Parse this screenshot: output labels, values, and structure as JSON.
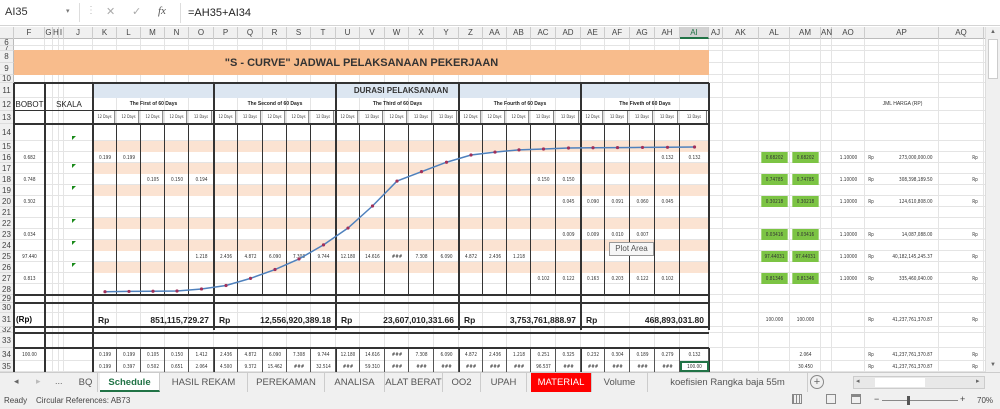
{
  "formula_bar": {
    "name_box": "AI35",
    "cancel_icon": "✕",
    "enter_icon": "✓",
    "fx_label": "fx",
    "formula": "=AH35+AI34"
  },
  "columns": [
    "F",
    "G",
    "H",
    "I",
    "J",
    "K",
    "L",
    "M",
    "N",
    "O",
    "P",
    "Q",
    "R",
    "S",
    "T",
    "U",
    "V",
    "W",
    "X",
    "Y",
    "Z",
    "AA",
    "AB",
    "AC",
    "AD",
    "AE",
    "AF",
    "AG",
    "AH",
    "AI",
    "AJ",
    "AK",
    "AL",
    "AM",
    "AN",
    "AO",
    "AP",
    "AQ"
  ],
  "selected_column": "AI",
  "title": "\"S - CURVE\" JADWAL PELAKSANAAN PEKERJAAN",
  "headers": {
    "bobot": "BOBOT",
    "skala": "SKALA",
    "durasi": "DURASI PELAKSANAAN",
    "jml_harga": "JML HARGA (RP)",
    "periods": [
      "The First of 60 Days",
      "The Second of 60 Days",
      "The Third of 60 Days",
      "The Fourth of 60 Days",
      "The Fiveth of 60 Days"
    ],
    "sub_period": "12 Days"
  },
  "colors": {
    "title_band": "#f8bc8c",
    "header_band": "#dce6f1",
    "stripe": "#fbe3d2",
    "green_cell": "#7cc444",
    "curve": "#4f81bd",
    "marker": "#a0305a",
    "active_tab": "#217346",
    "material_tab": "#ff0000"
  },
  "rows": [
    {
      "row": "16",
      "cells": {
        "F": "0.682",
        "K": "0.199",
        "L": "0.199",
        "AH": "0.132",
        "AI": "0.132",
        "AL": "0.68202",
        "AM": "0.68202",
        "AO": "1.10000",
        "AP_rp": "Rp",
        "AP": "273,000,000.00",
        "AQ": "Rp"
      }
    },
    {
      "row": "18",
      "cells": {
        "F": "0.748",
        "M": "0.105",
        "N": "0.150",
        "O": "0.194",
        "AC": "0.150",
        "AD": "0.150",
        "AL": "0.74785",
        "AM": "0.74785",
        "AO": "1.10000",
        "AP_rp": "Rp",
        "AP": "308,398,189.50",
        "AQ": "Rp"
      }
    },
    {
      "row": "20",
      "cells": {
        "F": "0.302",
        "AD": "0.045",
        "AE": "0.090",
        "AF": "0.091",
        "AG": "0.060",
        "AH": "0.045",
        "AL": "0.30218",
        "AM": "0.30218",
        "AO": "1.10000",
        "AP_rp": "Rp",
        "AP": "124,610,808.00",
        "AQ": "Rp"
      }
    },
    {
      "row": "23",
      "cells": {
        "F": "0.034",
        "AD": "0.009",
        "AE": "0.009",
        "AF": "0.010",
        "AG": "0.007",
        "AL": "0.03416",
        "AM": "0.03416",
        "AO": "1.10000",
        "AP_rp": "Rp",
        "AP": "14,087,088.00",
        "AQ": "Rp"
      }
    },
    {
      "row": "25",
      "cells": {
        "F": "97.440",
        "O": "1.218",
        "P": "2.436",
        "Q": "4.872",
        "R": "6.090",
        "S": "7.308",
        "T": "9.744",
        "U": "12.180",
        "V": "14.616",
        "W": "###",
        "X": "7.308",
        "Y": "6.090",
        "Z": "4.872",
        "AA": "2.436",
        "AB": "1.218",
        "AL": "97.44031",
        "AM": "97.44031",
        "AO": "1.10000",
        "AP_rp": "Rp",
        "AP": "40,182,145,245.37",
        "AQ": "Rp"
      }
    },
    {
      "row": "27",
      "cells": {
        "F": "0.813",
        "AC": "0.102",
        "AD": "0.122",
        "AE": "0.163",
        "AF": "0.203",
        "AG": "0.122",
        "AH": "0.102",
        "AL": "0.81346",
        "AM": "0.81346",
        "AO": "1.10000",
        "AP_rp": "Rp",
        "AP": "335,460,040.00",
        "AQ": "Rp"
      }
    },
    {
      "row": "31",
      "cells": {
        "F": "(Rp)",
        "AL": "100.000",
        "AM": "100.000",
        "AP_rp": "Rp",
        "AP": "41,237,761,370.87",
        "AQ": "Rp"
      }
    },
    {
      "row": "34",
      "cells": {
        "F": "100.00",
        "K": "0.199",
        "L": "0.199",
        "M": "0.105",
        "N": "0.150",
        "O": "1.412",
        "P": "2.436",
        "Q": "4.872",
        "R": "6.090",
        "S": "7.308",
        "T": "9.744",
        "U": "12.180",
        "V": "14.616",
        "W": "###",
        "X": "7.308",
        "Y": "6.090",
        "Z": "4.872",
        "AA": "2.436",
        "AB": "1.218",
        "AC": "0.251",
        "AD": "0.325",
        "AE": "0.232",
        "AF": "0.304",
        "AG": "0.189",
        "AH": "0.279",
        "AI": "0.132",
        "AM": "2.064",
        "AP_rp": "Rp",
        "AP": "41,237,761,370.87",
        "AQ": "Rp"
      }
    },
    {
      "row": "35",
      "cells": {
        "K": "0.199",
        "L": "0.397",
        "M": "0.502",
        "N": "0.651",
        "O": "2.064",
        "P": "4.500",
        "Q": "9.372",
        "R": "15.462",
        "S": "###",
        "T": "32.514",
        "U": "###",
        "V": "59.310",
        "W": "###",
        "X": "###",
        "Y": "###",
        "Z": "###",
        "AA": "###",
        "AB": "###",
        "AC": "96.537",
        "AD": "###",
        "AE": "###",
        "AF": "###",
        "AG": "###",
        "AH": "###",
        "AI": "100.00",
        "AM": "30.450",
        "AP_rp": "Rp",
        "AP": "41,237,761,370.87",
        "AQ": "Rp"
      }
    }
  ],
  "period_totals": [
    {
      "currency": "Rp",
      "amount": "851,115,729.27"
    },
    {
      "currency": "Rp",
      "amount": "12,556,920,389.18"
    },
    {
      "currency": "Rp",
      "amount": "23,607,010,331.66"
    },
    {
      "currency": "Rp",
      "amount": "3,753,761,888.97"
    },
    {
      "currency": "Rp",
      "amount": "468,893,031.80"
    }
  ],
  "chart_data": {
    "type": "line",
    "x": [
      1,
      2,
      3,
      4,
      5,
      6,
      7,
      8,
      9,
      10,
      11,
      12,
      13,
      14,
      15,
      16,
      17,
      18,
      19,
      20,
      21,
      22,
      23,
      24,
      25
    ],
    "series": [
      {
        "values": [
          0.2,
          0.4,
          0.5,
          0.7,
          2.1,
          4.5,
          9.4,
          15.5,
          22.8,
          32.5,
          44.1,
          59.3,
          76.5,
          83.0,
          89.5,
          94.5,
          96.5,
          98.0,
          98.6,
          99.3,
          99.5,
          99.6,
          99.7,
          99.8,
          100
        ]
      }
    ],
    "ylim": [
      0,
      100
    ],
    "tooltip": "Plot Area"
  },
  "sheet_tabs": [
    "BQ",
    "Schedule",
    "HASIL REKAM",
    "PEREKAMAN",
    "ANALISA",
    "ALAT BERAT",
    "OO2",
    "UPAH",
    "MATERIAL",
    "Volume",
    "koefisien Rangka baja 55m"
  ],
  "active_tab": "Schedule",
  "tab_nav": {
    "prev": "◂",
    "next": "▸",
    "more": "...",
    "add": "+"
  },
  "status": {
    "ready": "Ready",
    "circular": "Circular References: AB73",
    "zoom": "70%"
  }
}
